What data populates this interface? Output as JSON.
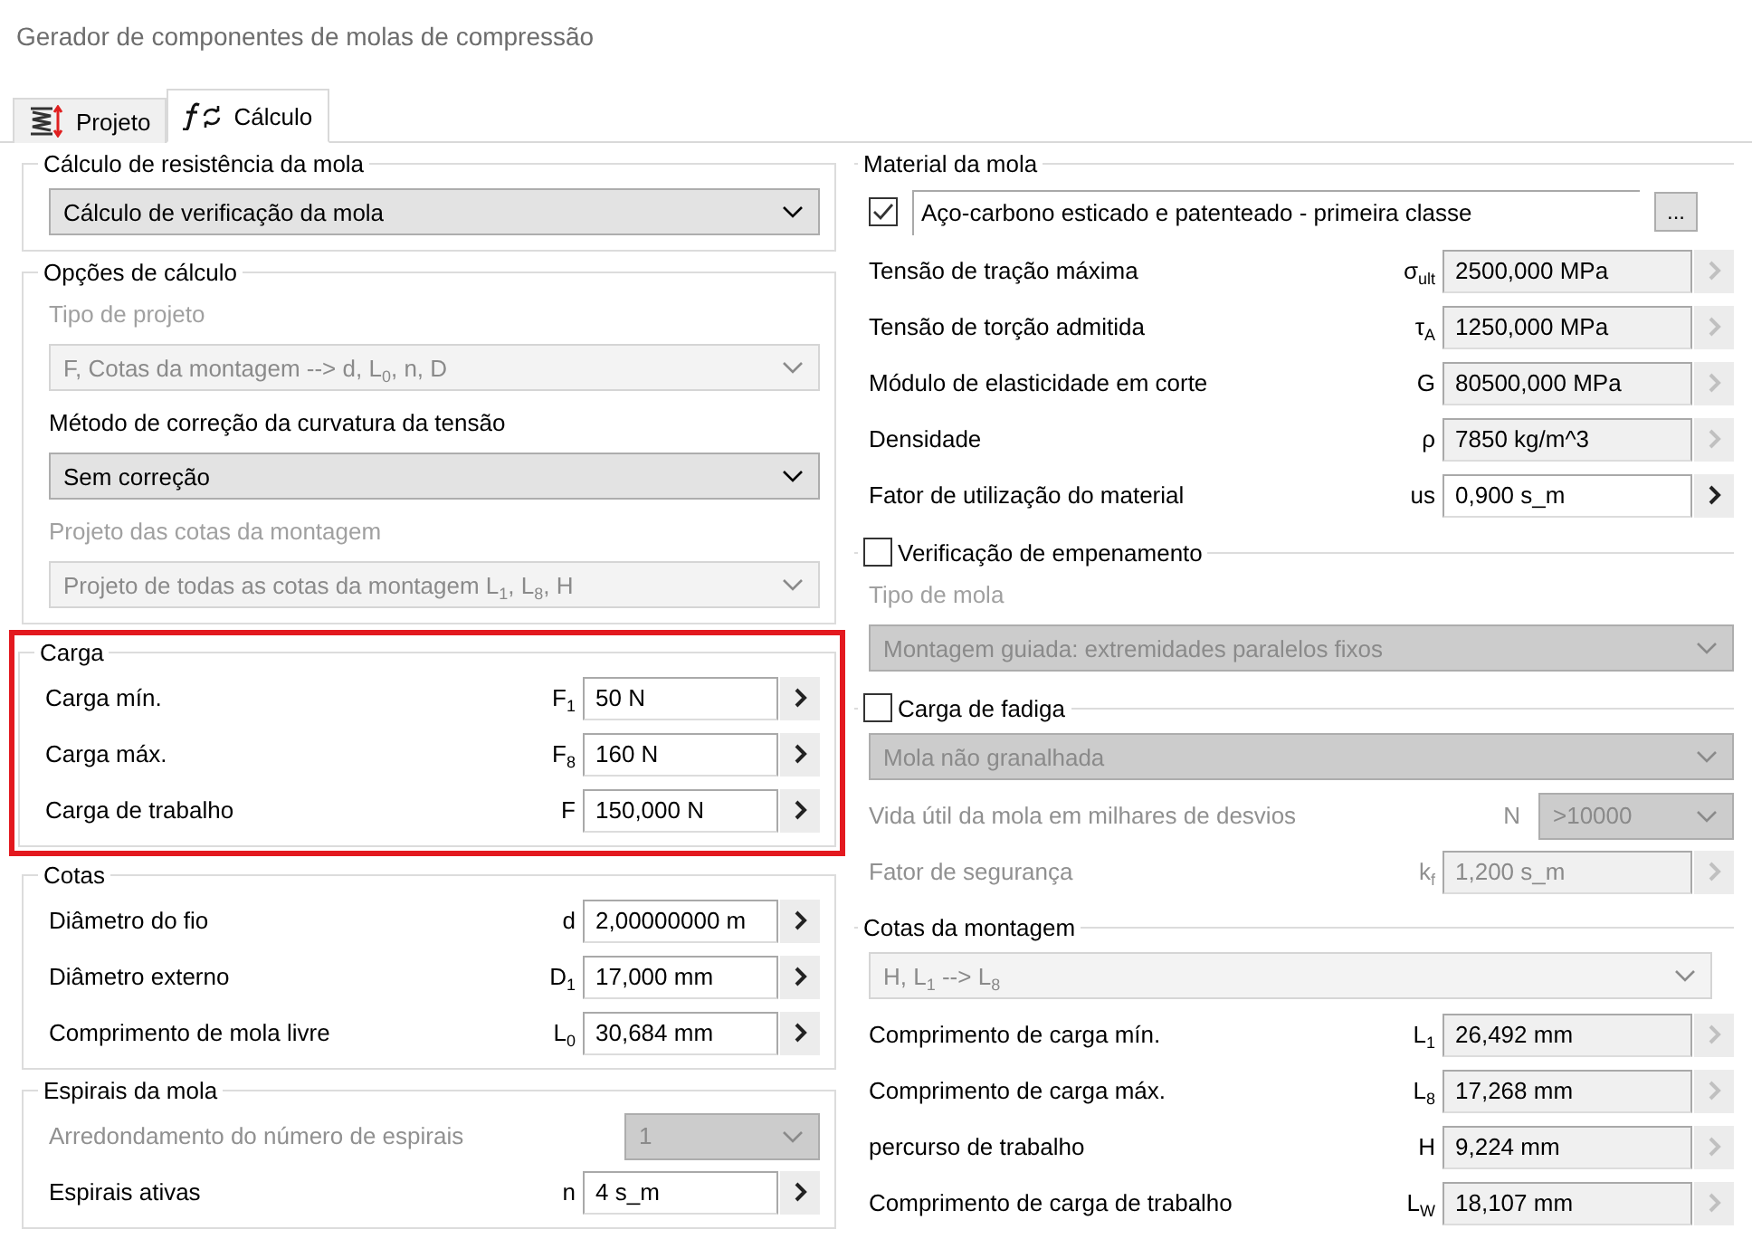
{
  "window": {
    "title": "Gerador de componentes de molas de compressão"
  },
  "tabs": [
    {
      "label": "Projeto",
      "kind": "design",
      "selected": false
    },
    {
      "label": "Cálculo",
      "kind": "calc",
      "selected": true
    }
  ],
  "left_groups": [
    {
      "legend": "Cálculo de resistência da mola",
      "highlighted": false,
      "items": [
        {
          "kind": "dropdown",
          "value": "Cálculo de verificação da mola",
          "disabled": false
        }
      ]
    },
    {
      "legend": "Opções de cálculo",
      "highlighted": false,
      "items": [
        {
          "kind": "caption",
          "text": "Tipo de projeto",
          "disabled": true
        },
        {
          "kind": "dropdown",
          "value": "F, Cotas da montagem --> d, L$_{0}$, n, D",
          "disabled": true,
          "editable": true
        },
        {
          "kind": "caption",
          "text": "Método de correção da curvatura da tensão",
          "disabled": false
        },
        {
          "kind": "dropdown",
          "value": "Sem correção",
          "disabled": false
        },
        {
          "kind": "caption",
          "text": "Projeto das cotas da montagem",
          "disabled": true
        },
        {
          "kind": "dropdown",
          "value": "Projeto de todas as cotas da montagem L$_{1}$, L$_{8}$, H",
          "disabled": true,
          "editable": true
        }
      ]
    },
    {
      "legend": "Carga",
      "highlighted": true,
      "items": [
        {
          "kind": "field",
          "label": "Carga mín.",
          "symbol": "F$_{1}$",
          "value": "50 N",
          "readonly": false,
          "disabled": false
        },
        {
          "kind": "field",
          "label": "Carga máx.",
          "symbol": "F$_{8}$",
          "value": "160 N",
          "readonly": false,
          "disabled": false
        },
        {
          "kind": "field",
          "label": "Carga de trabalho",
          "symbol": "F",
          "value": "150,000 N",
          "readonly": false,
          "disabled": false
        }
      ]
    },
    {
      "legend": "Cotas",
      "highlighted": false,
      "items": [
        {
          "kind": "field",
          "label": "Diâmetro do fio",
          "symbol": "d",
          "value": "2,00000000 m",
          "readonly": false,
          "disabled": false
        },
        {
          "kind": "field",
          "label": "Diâmetro externo",
          "symbol": "D$_{1}$",
          "value": "17,000 mm",
          "readonly": false,
          "disabled": false
        },
        {
          "kind": "field",
          "label": "Comprimento de mola livre",
          "symbol": "L$_{0}$",
          "value": "30,684 mm",
          "readonly": false,
          "disabled": false
        }
      ]
    },
    {
      "legend": "Espirais da mola",
      "highlighted": false,
      "items": [
        {
          "kind": "select_row",
          "label": "Arredondamento do número de espirais",
          "value": "1",
          "disabled": true
        },
        {
          "kind": "field",
          "label": "Espirais ativas",
          "symbol": "n",
          "value": "4 s_m",
          "readonly": false,
          "disabled": false
        }
      ]
    }
  ],
  "right_groups": [
    {
      "legend": "Material da mola",
      "items": [
        {
          "kind": "material",
          "checked": true,
          "value": "Aço-carbono esticado e patenteado - primeira classe",
          "button": "..."
        },
        {
          "kind": "field",
          "label": "Tensão de tração máxima",
          "symbol": "σ$_{ult}$",
          "value": "2500,000 MPa",
          "readonly": true,
          "disabled": false
        },
        {
          "kind": "field",
          "label": "Tensão de torção admitida",
          "symbol": "τ$_{A}$",
          "value": "1250,000 MPa",
          "readonly": true,
          "disabled": false
        },
        {
          "kind": "field",
          "label": "Módulo de elasticidade em corte",
          "symbol": "G",
          "value": "80500,000 MPa",
          "readonly": true,
          "disabled": false
        },
        {
          "kind": "field",
          "label": "Densidade",
          "symbol": "ρ",
          "value": "7850 kg/m^3",
          "readonly": true,
          "disabled": false
        },
        {
          "kind": "field",
          "label": "Fator de utilização do material",
          "symbol": "us",
          "value": "0,900 s_m",
          "readonly": false,
          "disabled": false
        }
      ]
    },
    {
      "legend": "Verificação de empenamento",
      "checked": false,
      "items": [
        {
          "kind": "caption",
          "text": "Tipo de mola",
          "disabled": true
        },
        {
          "kind": "dropdown",
          "value": "Montagem guiada: extremidades paralelos fixos",
          "disabled": true,
          "editable": false
        }
      ]
    },
    {
      "legend": "Carga de fadiga",
      "checked": false,
      "items": [
        {
          "kind": "dropdown",
          "value": "Mola não granalhada",
          "disabled": true,
          "editable": false
        },
        {
          "kind": "select_row",
          "label": "Vida útil da mola em milhares de desvios",
          "symbol": "N",
          "value": ">10000",
          "disabled": true
        },
        {
          "kind": "field",
          "label": "Fator de segurança",
          "symbol": "k$_{f}$",
          "value": "1,200 s_m",
          "readonly": true,
          "disabled": true
        }
      ]
    },
    {
      "legend": "Cotas da montagem",
      "items": [
        {
          "kind": "dropdown",
          "value": "H, L$_{1}$ --> L$_{8}$",
          "disabled": true,
          "editable": true,
          "narrow": true
        },
        {
          "kind": "field",
          "label": "Comprimento de carga mín.",
          "symbol": "L$_{1}$",
          "value": "26,492 mm",
          "readonly": true,
          "disabled": false
        },
        {
          "kind": "field",
          "label": "Comprimento de carga máx.",
          "symbol": "L$_{8}$",
          "value": "17,268 mm",
          "readonly": true,
          "disabled": false
        },
        {
          "kind": "field",
          "label": "percurso de trabalho",
          "symbol": "H",
          "value": "9,224 mm",
          "readonly": true,
          "disabled": false
        },
        {
          "kind": "field",
          "label": "Comprimento de carga de trabalho",
          "symbol": "L$_{W}$",
          "value": "18,107 mm",
          "readonly": true,
          "disabled": false
        }
      ]
    }
  ]
}
